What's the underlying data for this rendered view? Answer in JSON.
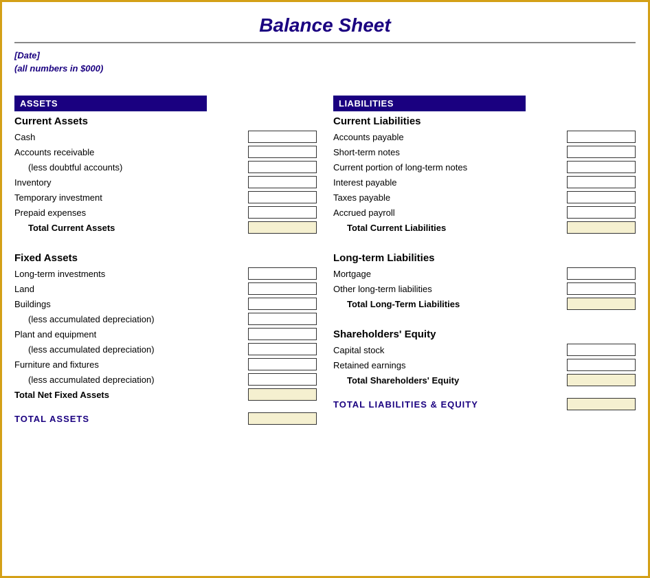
{
  "title": "Balance Sheet",
  "date_label": "[Date]",
  "subtitle": "(all numbers in $000)",
  "assets": {
    "header": "ASSETS",
    "current_assets_title": "Current Assets",
    "items": [
      {
        "label": "Cash",
        "indented": false
      },
      {
        "label": "Accounts receivable",
        "indented": false
      },
      {
        "label": "(less doubtful accounts)",
        "indented": true
      },
      {
        "label": "Inventory",
        "indented": false
      },
      {
        "label": "Temporary investment",
        "indented": false
      },
      {
        "label": "Prepaid expenses",
        "indented": false
      }
    ],
    "total_current": "Total Current Assets",
    "fixed_assets_title": "Fixed Assets",
    "fixed_items": [
      {
        "label": "Long-term investments",
        "indented": false
      },
      {
        "label": "Land",
        "indented": false
      },
      {
        "label": "Buildings",
        "indented": false
      },
      {
        "label": "(less accumulated depreciation)",
        "indented": true
      },
      {
        "label": "Plant and equipment",
        "indented": false
      },
      {
        "label": "(less accumulated depreciation)",
        "indented": true
      },
      {
        "label": "Furniture and fixtures",
        "indented": false
      },
      {
        "label": "(less accumulated depreciation)",
        "indented": true
      }
    ],
    "total_net_fixed": "Total Net Fixed Assets",
    "total_assets_label": "TOTAL ASSETS"
  },
  "liabilities": {
    "header": "LIABILITIES",
    "current_liabilities_title": "Current Liabilities",
    "items": [
      {
        "label": "Accounts payable",
        "indented": false
      },
      {
        "label": "Short-term notes",
        "indented": false
      },
      {
        "label": "Current portion of long-term notes",
        "indented": false
      },
      {
        "label": "Interest payable",
        "indented": false
      },
      {
        "label": "Taxes payable",
        "indented": false
      },
      {
        "label": "Accrued payroll",
        "indented": false
      }
    ],
    "total_current": "Total Current Liabilities",
    "longterm_title": "Long-term Liabilities",
    "longterm_items": [
      {
        "label": "Mortgage",
        "indented": false
      },
      {
        "label": "Other long-term liabilities",
        "indented": false
      }
    ],
    "total_longterm": "Total Long-Term Liabilities",
    "equity_title": "Shareholders' Equity",
    "equity_items": [
      {
        "label": "Capital stock",
        "indented": false
      },
      {
        "label": "Retained earnings",
        "indented": false
      }
    ],
    "total_equity": "Total Shareholders' Equity",
    "total_liabilities_label": "TOTAL LIABILITIES & EQUITY"
  }
}
